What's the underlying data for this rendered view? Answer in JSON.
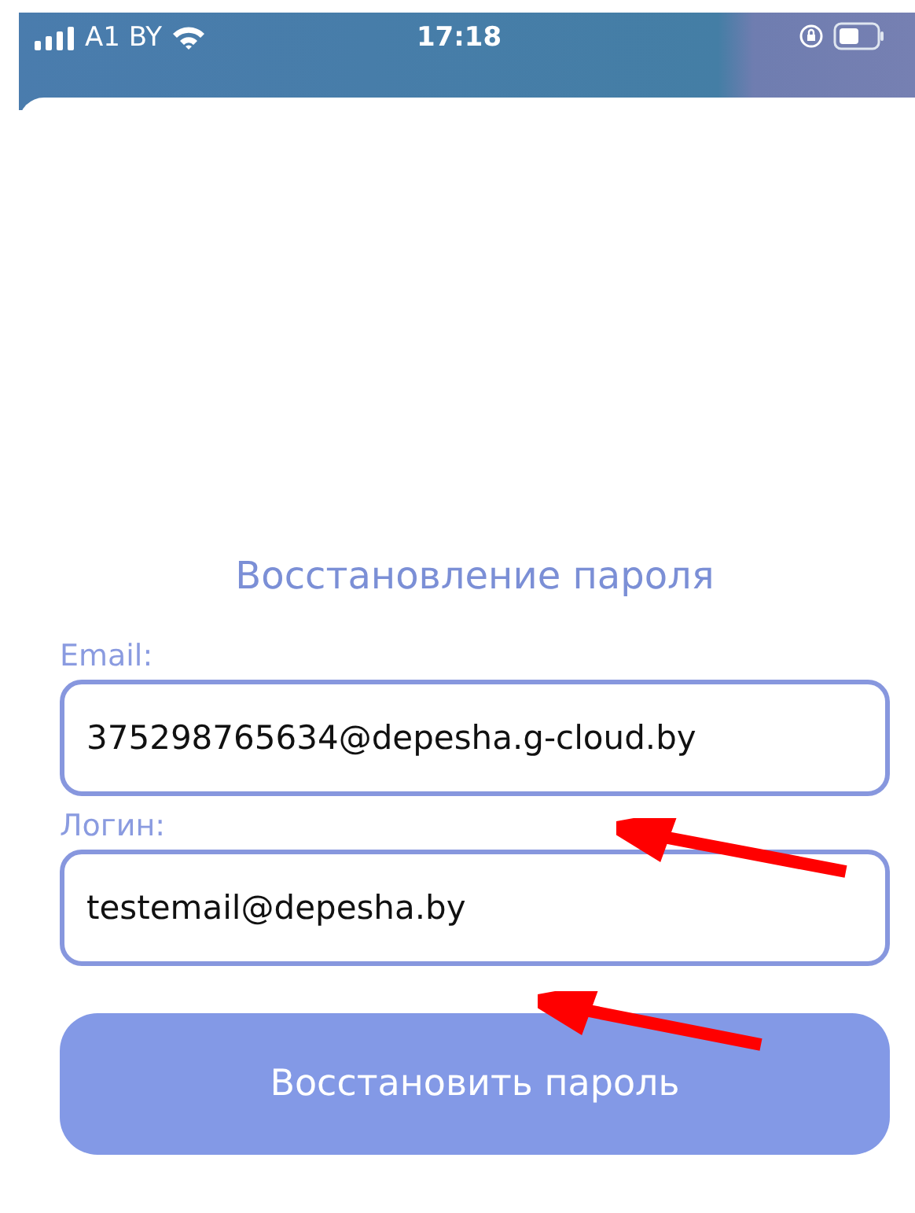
{
  "status_bar": {
    "carrier": "A1 BY",
    "time": "17:18"
  },
  "title": "Восстановление пароля",
  "fields": [
    {
      "label": "Email:",
      "value": "375298765634@depesha.g-cloud.by"
    },
    {
      "label": "Логин:",
      "value": "testemail@depesha.by"
    }
  ],
  "button": "Восстановить пароль"
}
